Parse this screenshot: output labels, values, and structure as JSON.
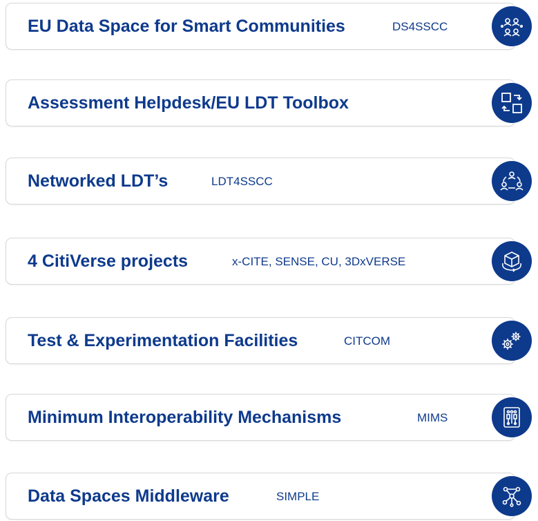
{
  "items": [
    {
      "title": "EU Data Space for Smart Communities",
      "tag": "DS4SSCC",
      "icon": "people-network-icon"
    },
    {
      "title": "Assessment Helpdesk/EU LDT Toolbox",
      "tag": "",
      "icon": "transform-squares-icon"
    },
    {
      "title": "Networked LDT’s",
      "tag": "LDT4SSCC",
      "icon": "connected-people-icon"
    },
    {
      "title": "4 CitiVerse projects",
      "tag": "x-CITE, SENSE, CU, 3DxVERSE",
      "icon": "3d-cube-icon"
    },
    {
      "title": "Test & Experimentation Facilities",
      "tag": "CITCOM",
      "icon": "gears-icon"
    },
    {
      "title": "Minimum Interoperability  Mechanisms",
      "tag": "MIMS",
      "icon": "circuit-board-icon"
    },
    {
      "title": "Data Spaces Middleware",
      "tag": "SIMPLE",
      "icon": "network-nodes-icon"
    }
  ],
  "colors": {
    "accent": "#0e3a8c",
    "border": "#d7d7d7",
    "background": "#ffffff"
  }
}
